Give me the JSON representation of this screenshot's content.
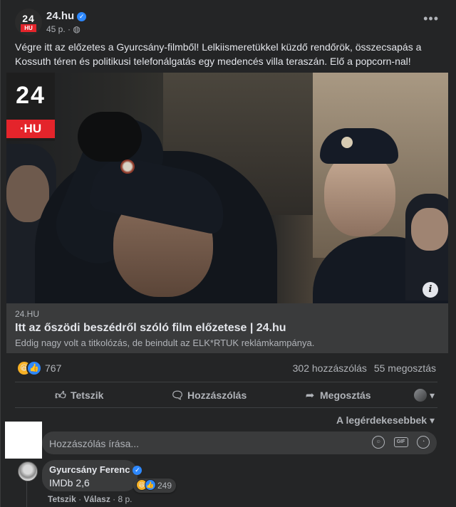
{
  "post": {
    "page_name": "24.hu",
    "avatar": {
      "top": "24",
      "badge": "HU"
    },
    "time": "45 p.",
    "audience_icon": "globe-icon",
    "more_label": "•••",
    "text": "Végre itt az előzetes a Gyurcsány-filmből! Lelkiismeretükkel küzdő rendőrök, összecsapás a Kossuth téren és politikusi telefonálgatás egy medencés villa teraszán. Elő a popcorn-nal!"
  },
  "image": {
    "logo_top": "24",
    "logo_badge": "·HU",
    "info_label": "i"
  },
  "link": {
    "domain": "24.HU",
    "title": "Itt az őszödi beszédről szóló film előzetese | 24.hu",
    "description": "Eddig nagy volt a titkolózás, de beindult az ELK*RTUK reklámkampánya."
  },
  "stats": {
    "reaction_icons": [
      "haha-emoji",
      "like-emoji"
    ],
    "reaction_count": "767",
    "comments": "302 hozzászólás",
    "shares": "55 megosztás"
  },
  "actions": {
    "like": "Tetszik",
    "comment": "Hozzászólás",
    "share": "Megosztás"
  },
  "sort_label": "A legérdekesebbek",
  "comment_input": {
    "placeholder": "Hozzászólás írása..."
  },
  "comment": {
    "author": "Gyurcsány Ferenc",
    "text": "IMDb 2,6",
    "reaction_count": "249",
    "like_label": "Tetszik",
    "reply_label": "Válasz",
    "time": "8 p."
  },
  "colors": {
    "background": "#242526",
    "surface": "#3a3b3c",
    "text_primary": "#e4e6eb",
    "text_secondary": "#b0b3b8",
    "accent_blue": "#2d88ff",
    "brand_red": "#e4242b"
  }
}
